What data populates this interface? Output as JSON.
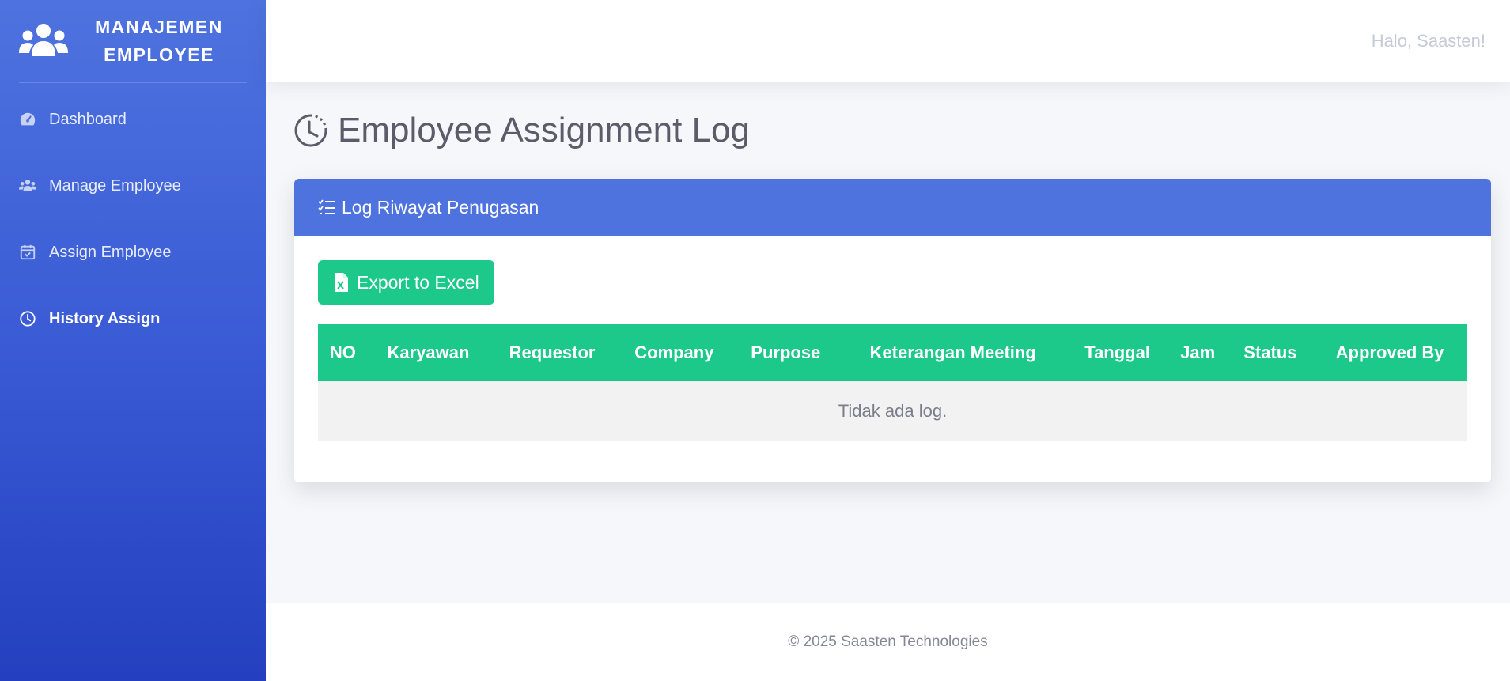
{
  "brand": {
    "line1": "MANAJEMEN",
    "line2": "EMPLOYEE",
    "icon": "users-icon"
  },
  "sidebar": {
    "items": [
      {
        "label": "Dashboard",
        "icon": "tachometer-icon",
        "active": false
      },
      {
        "label": "Manage Employee",
        "icon": "users-icon",
        "active": false
      },
      {
        "label": "Assign Employee",
        "icon": "calendar-check-icon",
        "active": false
      },
      {
        "label": "History Assign",
        "icon": "clock-icon",
        "active": true
      }
    ]
  },
  "topbar": {
    "greeting": "Halo, Saasten!"
  },
  "page": {
    "title": "Employee Assignment Log",
    "title_icon": "clock-history-icon"
  },
  "card": {
    "header": "Log Riwayat Penugasan",
    "header_icon": "list-check-icon",
    "export_label": "Export to Excel",
    "export_icon": "file-excel-icon"
  },
  "table": {
    "columns": [
      "NO",
      "Karyawan",
      "Requestor",
      "Company",
      "Purpose",
      "Keterangan Meeting",
      "Tanggal",
      "Jam",
      "Status",
      "Approved By"
    ],
    "empty_message": "Tidak ada log."
  },
  "footer": {
    "text": "© 2025 Saasten Technologies"
  },
  "colors": {
    "primary": "#4e73df",
    "success": "#1cc88a",
    "sidebar_gradient_end": "#2440c0",
    "text_muted": "#858796"
  }
}
